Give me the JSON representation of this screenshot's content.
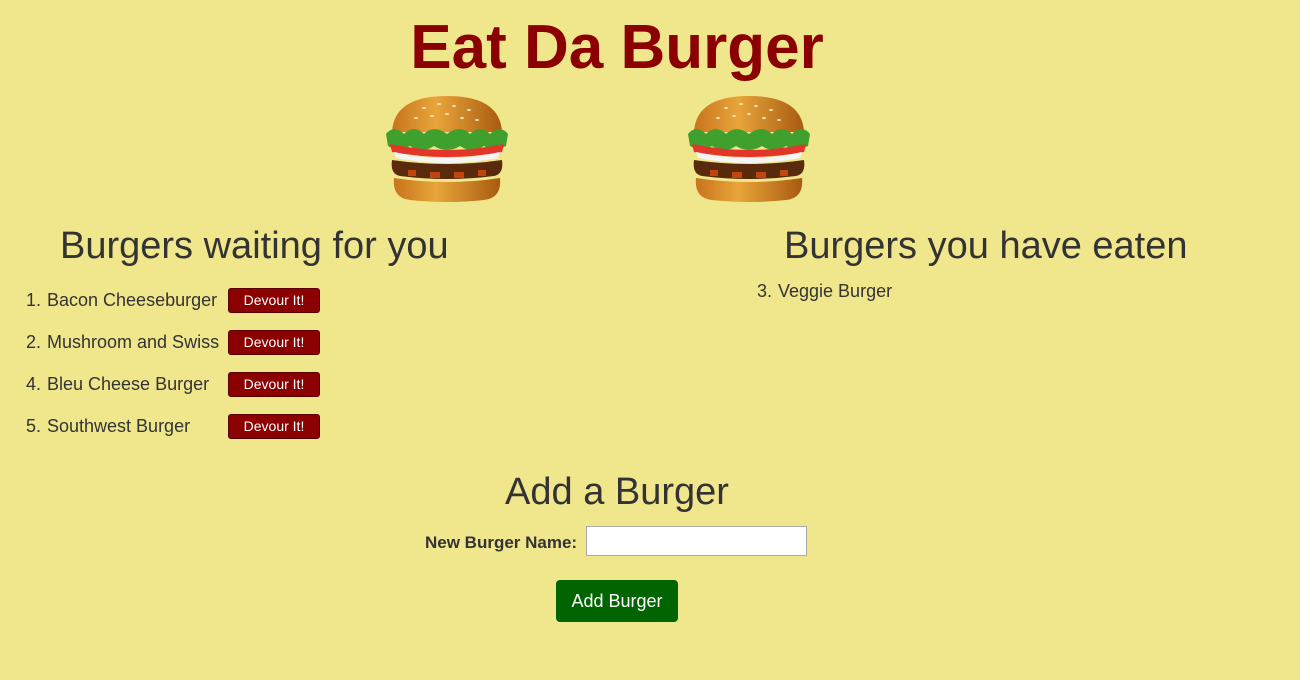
{
  "page_title": "Eat Da Burger",
  "icons": {
    "burger": "hamburger-icon"
  },
  "colors": {
    "background": "#f0e68c",
    "title": "#8b0000",
    "devour_button": "#8b0000",
    "add_button": "#006400"
  },
  "waiting": {
    "heading": "Burgers waiting for you",
    "items": [
      {
        "number": "1.",
        "name": "Bacon Cheeseburger",
        "button": "Devour It!"
      },
      {
        "number": "2.",
        "name": "Mushroom and Swiss",
        "button": "Devour It!"
      },
      {
        "number": "4.",
        "name": "Bleu Cheese Burger",
        "button": "Devour It!"
      },
      {
        "number": "5.",
        "name": "Southwest Burger",
        "button": "Devour It!"
      }
    ]
  },
  "eaten": {
    "heading": "Burgers you have eaten",
    "items": [
      {
        "number": "3.",
        "name": "Veggie Burger"
      }
    ]
  },
  "add_form": {
    "heading": "Add a Burger",
    "label": "New Burger Name:",
    "input_value": "",
    "button": "Add Burger"
  }
}
